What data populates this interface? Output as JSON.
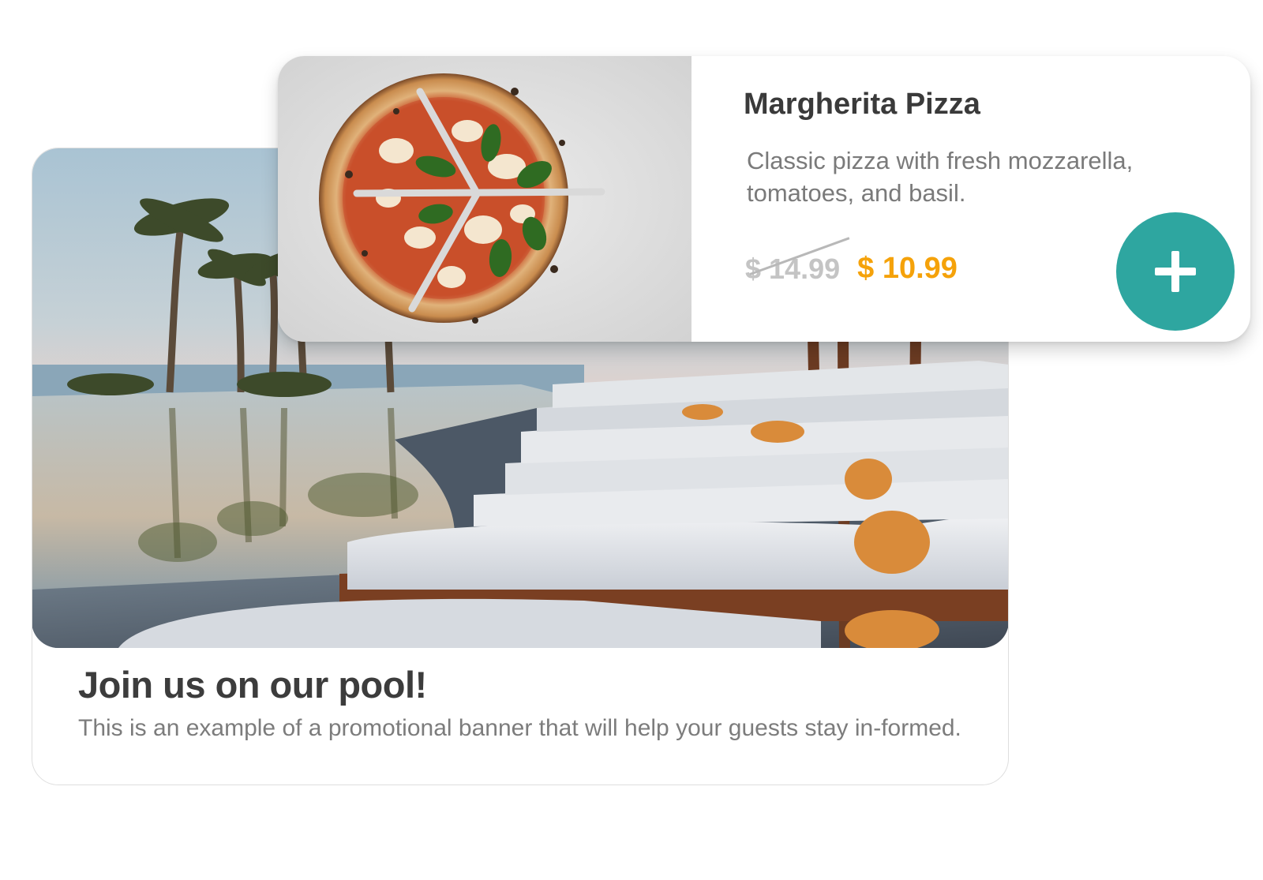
{
  "promo_banner": {
    "title": "Join us on our pool!",
    "description": "This is an example of a promotional banner that will help your guests stay in-formed.",
    "image": "pool-with-sun-loungers-and-palm-trees"
  },
  "product": {
    "name": "Margherita Pizza",
    "description": "Classic pizza with fresh mozzarella, tomatoes, and basil.",
    "old_price": "$ 14.99",
    "price": "$ 10.99",
    "image": "margherita-pizza",
    "add_icon": "plus-icon"
  },
  "colors": {
    "accent": "#2ea6a0",
    "price": "#f5a20a",
    "old_price": "#c4c4c4",
    "title_text": "#3c3c3c",
    "body_text": "#7a7a7a"
  }
}
